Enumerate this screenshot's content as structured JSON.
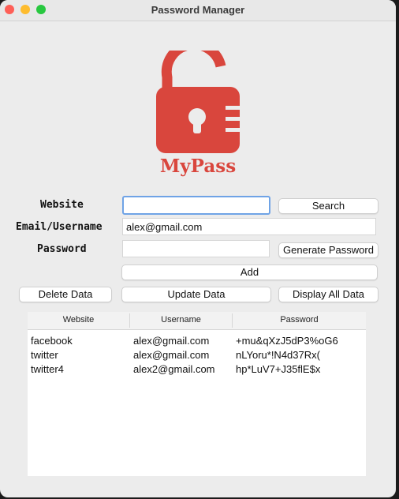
{
  "window": {
    "title": "Password Manager"
  },
  "logo": {
    "text": "MyPass",
    "color": "#d9463d"
  },
  "form": {
    "website_label": "Website",
    "website_value": "",
    "email_label": "Email/Username",
    "email_value": "alex@gmail.com",
    "password_label": "Password",
    "password_value": ""
  },
  "buttons": {
    "search": "Search",
    "generate": "Generate Password",
    "add": "Add",
    "delete": "Delete Data",
    "update": "Update Data",
    "display_all": "Display All Data"
  },
  "table": {
    "headers": [
      "Website",
      "Username",
      "Password"
    ],
    "rows": [
      [
        "facebook",
        "alex@gmail.com",
        "+mu&qXzJ5dP3%oG6"
      ],
      [
        "twitter",
        "alex@gmail.com",
        "nLYoru*!N4d37Rx("
      ],
      [
        "twitter4",
        "alex2@gmail.com",
        "hp*LuV7+J35flE$x"
      ]
    ]
  }
}
